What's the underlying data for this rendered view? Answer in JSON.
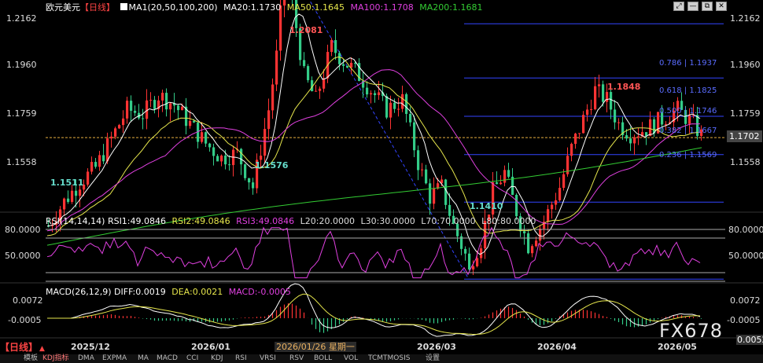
{
  "header": {
    "symbol": "欧元美元",
    "period": "【日线】",
    "ma_label": "MA1(20,50,100,200)",
    "ma20": "MA20:1.1730",
    "ma50": "MA50:1.1645",
    "ma100": "MA100:1.1708",
    "ma200": "MA200:1.1681"
  },
  "window_buttons": [
    "⤢",
    "—",
    "⧉",
    "✕"
  ],
  "price_axis": {
    "labels": [
      "1.2162",
      "1.1960",
      "1.1759",
      "1.1558"
    ],
    "values": [
      1.2162,
      1.196,
      1.1759,
      1.1558
    ],
    "current": "1.1702",
    "current_value": 1.1702
  },
  "annotations": {
    "high1": "1.2081",
    "low1": "1.1511",
    "low2": "1.1576",
    "low3": "1.1410",
    "high2": "1.1848"
  },
  "fib_labels": [
    "0.786 | 1.1937",
    "0.618 | 1.1825",
    "0.500 | 1.1746",
    "0.382 | 1.1667",
    "0.236 | 1.1569"
  ],
  "fib_values": [
    1.1937,
    1.1825,
    1.1746,
    1.1667,
    1.1569
  ],
  "rsi": {
    "title": "RSI(14,14,14)",
    "rsi1": "RSI1:49.0846",
    "rsi2": "RSI2:49.0846",
    "rsi3": "RSI3:49.0846",
    "l20": "L20:20.0000",
    "l30": "L30:30.0000",
    "l70": "L70:70.0000",
    "l80": "L80:80.0000",
    "axis": [
      "80.0000",
      "50.0000"
    ]
  },
  "macd": {
    "title": "MACD(26,12,9)",
    "diff": "DIFF:0.0019",
    "dea": "DEA:0.0021",
    "macd": "MACD:-0.0005",
    "axis": [
      "0.0072",
      "-0.0005"
    ],
    "axis_cut": "0.0052"
  },
  "time_axis": {
    "labels": [
      "2025/12",
      "2026/01",
      "2026/03",
      "2026/04",
      "2026/05"
    ],
    "cursor_date": "2026/01/26 星期一"
  },
  "watermark": "FX678",
  "bottom_tabs": [
    "模板",
    "KDJ指标",
    "DMA",
    "EXPMA",
    "MA",
    "MACD",
    "CCI",
    "KDJ",
    "RSI",
    "VRSI",
    "RSV",
    "BOLL",
    "VOL",
    "TCMTMOSIS",
    "设置"
  ],
  "colors": {
    "up": "#ff3333",
    "down": "#33cc88",
    "ma20": "#ffffff",
    "ma50": "#e6e64c",
    "ma100": "#e040e0",
    "ma200": "#33cc33",
    "fib": "#3344ff",
    "current_price_bg": "#444444"
  },
  "chart_data": [
    {
      "type": "candlestick",
      "title": "欧元美元 日线",
      "y_range": [
        1.135,
        1.2215
      ],
      "x_labels": [
        "2025/12",
        "2026/01",
        "2026/03",
        "2026/04",
        "2026/05"
      ],
      "key_points": [
        {
          "label": "low",
          "value": 1.1511
        },
        {
          "label": "low",
          "value": 1.1576
        },
        {
          "label": "high",
          "value": 1.2081
        },
        {
          "label": "low",
          "value": 1.141
        },
        {
          "label": "high",
          "value": 1.1848
        },
        {
          "label": "last",
          "value": 1.1702
        }
      ],
      "fibonacci": [
        {
          "level": "0.786",
          "value": 1.1937
        },
        {
          "level": "0.618",
          "value": 1.1825
        },
        {
          "level": "0.500",
          "value": 1.1746
        },
        {
          "level": "0.382",
          "value": 1.1667
        },
        {
          "level": "0.236",
          "value": 1.1569
        }
      ],
      "series": [
        {
          "name": "MA20",
          "last": 1.173
        },
        {
          "name": "MA50",
          "last": 1.1645
        },
        {
          "name": "MA100",
          "last": 1.1708
        },
        {
          "name": "MA200",
          "last": 1.1681
        }
      ]
    },
    {
      "type": "line",
      "title": "RSI(14,14,14)",
      "y_levels": [
        80,
        50
      ],
      "series": [
        {
          "name": "RSI1",
          "last": 49.0846
        }
      ]
    },
    {
      "type": "bar",
      "title": "MACD(26,12,9)",
      "y_levels": [
        0.0072,
        -0.0005
      ],
      "series": [
        {
          "name": "DIFF",
          "last": 0.0019
        },
        {
          "name": "DEA",
          "last": 0.0021
        },
        {
          "name": "MACD",
          "last": -0.0005
        }
      ]
    }
  ]
}
